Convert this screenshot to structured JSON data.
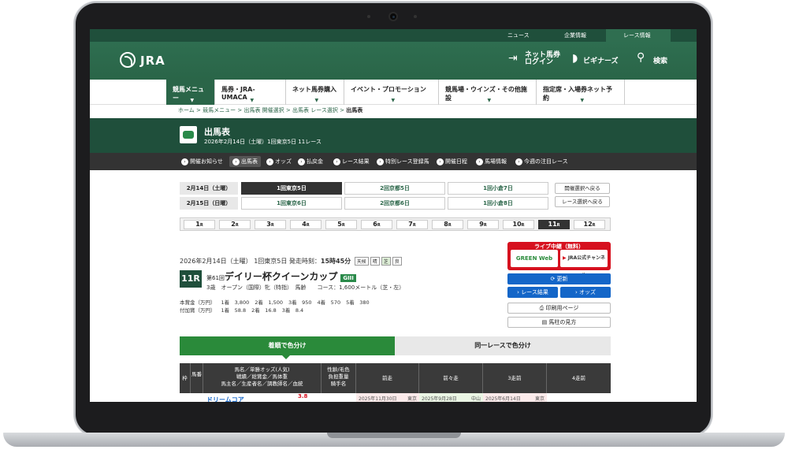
{
  "colors": {
    "primary": "#2a6548",
    "dark": "#1f4f3b",
    "live": "#d6111f",
    "blue": "#1466c8"
  },
  "topbar": {
    "links": [
      "ニュース",
      "企業情報",
      "レース情報"
    ]
  },
  "header": {
    "logo": "JRA",
    "net_bet": "ネット馬券\nログイン",
    "beginners": "ビギナーズ",
    "search": "検索"
  },
  "nav": {
    "items": [
      "競馬メニュー",
      "馬券・JRA-UMACA",
      "ネット馬券購入",
      "イベント・プロモーション",
      "競馬場・ウインズ・その他施設",
      "指定席・入場券ネット予約"
    ]
  },
  "breadcrumb": {
    "items": [
      "ホーム",
      "競馬メニュー",
      "出馬表 開催選択",
      "出馬表 レース選択"
    ],
    "current": "出馬表"
  },
  "title": {
    "main": "出馬表",
    "sub": "2026年2月14日（土曜）1回東京5日 11レース"
  },
  "subnav": {
    "items": [
      "開催お知らせ",
      "出馬表",
      "オッズ",
      "払戻金",
      "レース結果",
      "特別レース登録馬",
      "開催日程",
      "馬場情報",
      "今週の注目レース"
    ]
  },
  "days": [
    {
      "label": "2月14日（土曜）",
      "venues": [
        "1回東京5日",
        "2回京都5日",
        "1回小倉7日"
      ]
    },
    {
      "label": "2月15日（日曜）",
      "venues": [
        "1回東京6日",
        "2回京都6日",
        "1回小倉8日"
      ]
    }
  ],
  "side_buttons": [
    "開催選択へ戻る",
    "レース選択へ戻る"
  ],
  "races": [
    "1",
    "2",
    "3",
    "4",
    "5",
    "6",
    "7",
    "8",
    "9",
    "10",
    "11",
    "12"
  ],
  "race_unit": "R",
  "race": {
    "date": "2026年2月14日（土曜）",
    "meeting": "1回東京5日",
    "start_label": "発走時刻：",
    "start_time": "15時45分",
    "weather_labels": [
      "天候",
      "晴",
      "芝",
      "良"
    ],
    "number": "11R",
    "edition": "第61回",
    "name": "デイリー杯クイーンカップ",
    "grade": "GIII",
    "conditions": "3歳　オープン（国際）牝（特指）　馬齢　　コース：1,600メートル（芝・左）",
    "prize1_label": "本賞金（万円）",
    "prize1": [
      "1着　3,800",
      "2着　1,500",
      "3着　950",
      "4着　570",
      "5着　380"
    ],
    "prize2_label": "付加賞（万円）",
    "prize2": [
      "1着　58.8",
      "2着　16.8",
      "3着　8.4"
    ]
  },
  "live": {
    "label": "ライブ中継（無料）",
    "green": "GREEN Web",
    "youtube": "JRA公式チャンネル"
  },
  "buttons": {
    "refresh": "更新",
    "result": "レース結果",
    "odds": "オッズ",
    "print": "印刷用ページ",
    "guide": "馬柱の見方"
  },
  "tabs": {
    "color_by_time": "着順で色分け",
    "color_same_race": "同一レースで色分け"
  },
  "table": {
    "h_waku": "枠",
    "h_num": "馬番",
    "h_horse": [
      "馬名／単勝オッズ(人気)",
      "戦績／総賞金／馬体重",
      "馬主名／生産者名／調教師名／血統"
    ],
    "h_sex": [
      "性齢/毛色",
      "負担重量",
      "騎手名"
    ],
    "h_prev": [
      "前走",
      "前々走",
      "3走前",
      "4走前"
    ],
    "row1": {
      "horse": "ドリームコア",
      "odds": "3.8",
      "prev": [
        "2025年11月30日",
        "東京"
      ],
      "prev2": [
        "2025年9月28日",
        "中山"
      ],
      "prev3": [
        "2025年6月14日",
        "東京"
      ]
    }
  }
}
